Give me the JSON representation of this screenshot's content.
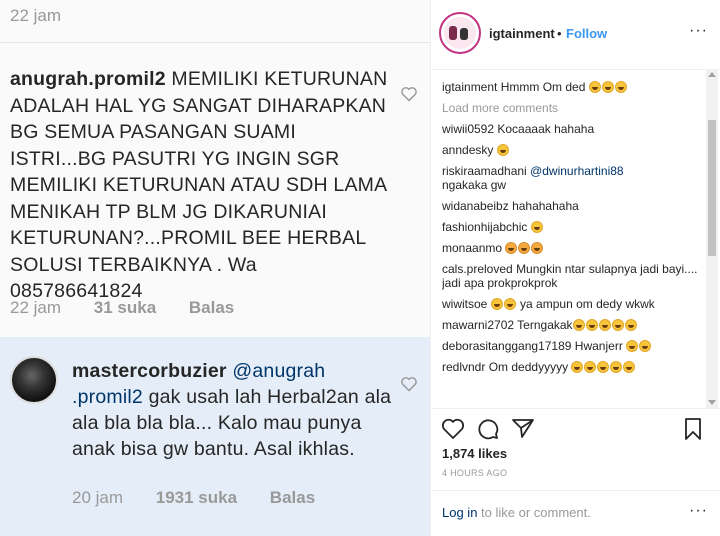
{
  "left": {
    "top_time": "22 jam",
    "comment1": {
      "username": "anugrah.promil2",
      "text": " MEMILIKI KETURUNAN ADALAH HAL YG SANGAT DIHARAPKAN BG SEMUA PASANGAN SUAMI ISTRI...BG PASUTRI YG INGIN SGR MEMILIKI KETURUNAN ATAU SDH LAMA MENIKAH TP BLM JG DIKARUNIAI KETURUNAN?...PROMIL BEE HERBAL SOLUSI TERBAIKNYA . Wa 085786641824",
      "time": "22 jam",
      "likes": "31 suka",
      "reply": "Balas"
    },
    "comment2": {
      "username": "mastercorbuzier",
      "mention": "@anugrah .promil2",
      "text": " gak usah lah Herbal2an ala ala bla bla bla... Kalo mau punya anak bisa gw bantu. Asal ikhlas.",
      "time": "20 jam",
      "likes": "1931 suka",
      "reply": "Balas"
    }
  },
  "right": {
    "header": {
      "username": "igtainment",
      "dot": "•",
      "follow": "Follow",
      "more": "···"
    },
    "caption": {
      "user": "igtainment",
      "text": "Hmmm Om ded"
    },
    "load_more": "Load more comments",
    "comments": [
      {
        "user": "wiwii0592",
        "text": "Kocaaaak hahaha"
      },
      {
        "user": "anndesky",
        "text": ""
      },
      {
        "user": "riskiraamadhani",
        "mention": "@dwinurhartini88",
        "text": "ngakaka gw"
      },
      {
        "user": "widanabeibz",
        "text": "hahahahaha"
      },
      {
        "user": "fashionhijabchic",
        "text": ""
      },
      {
        "user": "monaanmo",
        "text": ""
      },
      {
        "user": "cals.preloved",
        "text": "Mungkin ntar sulapnya jadi bayi.... jadi apa prokprokprok"
      },
      {
        "user": "wiwitsoe",
        "text": "ya ampun om dedy wkwk"
      },
      {
        "user": "mawarni2702",
        "text": "Terngakak"
      },
      {
        "user": "deborasitanggang17189",
        "text": "Hwanjerr"
      },
      {
        "user": "redlvndr",
        "text": "Om deddyyyyy"
      }
    ],
    "likes": "1,874 likes",
    "posted": "4 HOURS AGO",
    "footer": {
      "login": "Log in",
      "rest": " to like or comment.",
      "more": "···"
    }
  }
}
